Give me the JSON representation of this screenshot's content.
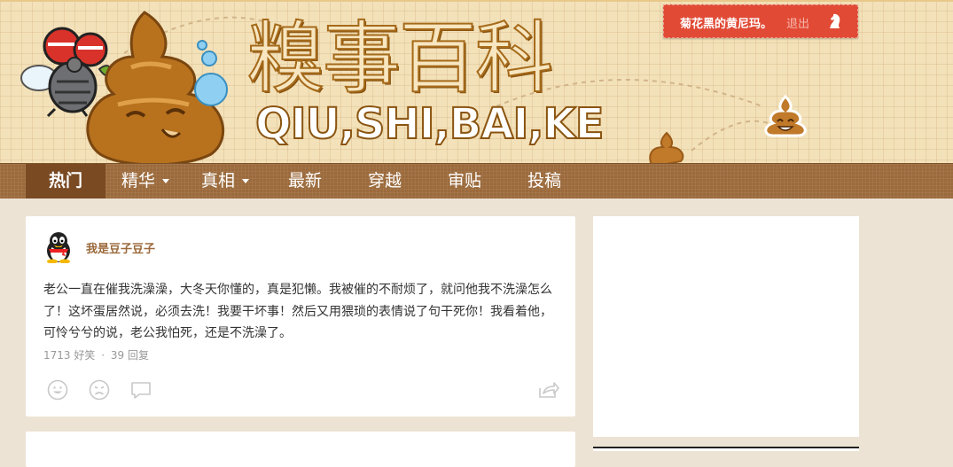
{
  "site": {
    "logo_cn": "糗事百科",
    "logo_en": "QIU,SHI,BAI,KE"
  },
  "user": {
    "name": "菊花黑的黄尼玛。",
    "logout": "退出"
  },
  "nav": {
    "items": [
      {
        "label": "热门",
        "active": true,
        "dropdown": false
      },
      {
        "label": "精华",
        "active": false,
        "dropdown": true
      },
      {
        "label": "真相",
        "active": false,
        "dropdown": true
      },
      {
        "label": "最新",
        "active": false,
        "dropdown": false
      },
      {
        "label": "穿越",
        "active": false,
        "dropdown": false
      },
      {
        "label": "审贴",
        "active": false,
        "dropdown": false
      },
      {
        "label": "投稿",
        "active": false,
        "dropdown": false
      }
    ]
  },
  "post": {
    "author": "我是豆子豆子",
    "content": "老公一直在催我洗澡澡，大冬天你懂的，真是犯懒。我被催的不耐烦了，就问他我不洗澡怎么了！这坏蛋居然说，必须去洗！我要干坏事！然后又用猥琐的表情说了句干死你！我看着他，可怜兮兮的说，老公我怕死，还是不洗澡了。",
    "funny_count": "1713",
    "funny_label": "好笑",
    "comment_count": "39",
    "comment_label": "回复",
    "separator": "·"
  },
  "icons": {
    "user_logout": "chess-knight-icon",
    "like": "smile-face-icon",
    "dislike": "frown-face-icon",
    "comment": "speech-bubble-icon",
    "share": "share-arrow-icon"
  },
  "colors": {
    "header_bg": "#f3e1b9",
    "nav_bg": "#9b6a3c",
    "nav_active": "#7a4a23",
    "user_box": "#e14a35",
    "page_bg": "#ede3d4",
    "author": "#9b6a3c"
  }
}
